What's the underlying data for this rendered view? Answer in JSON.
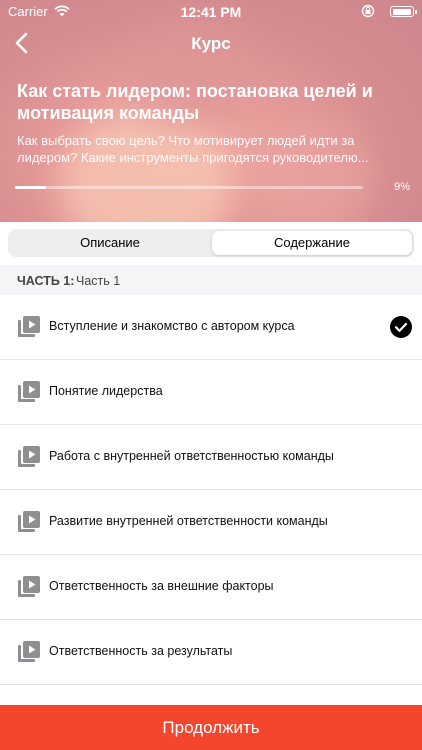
{
  "status_bar": {
    "carrier": "Carrier",
    "time": "12:41 PM"
  },
  "nav": {
    "title": "Курс",
    "back_icon": "chevron-left-icon"
  },
  "course": {
    "title": "Как стать лидером: постановка целей и мотивация команды",
    "description": "Как выбрать свою цель? Что мотивирует людей идти за лидером? Какие инструменты пригодятся руководителю...",
    "progress_percent": 9,
    "progress_label": "9%"
  },
  "tabs": [
    {
      "label": "Описание",
      "selected": false
    },
    {
      "label": "Содержание",
      "selected": true
    }
  ],
  "section": {
    "label": "ЧАСТЬ 1:",
    "value": "Часть 1"
  },
  "lessons": [
    {
      "title": "Вступление и знакомство с автором курса",
      "completed": true,
      "icon": "video-playlist-icon"
    },
    {
      "title": "Понятие лидерства",
      "completed": false,
      "icon": "video-playlist-icon"
    },
    {
      "title": "Работа с внутренней ответственностью команды",
      "completed": false,
      "icon": "video-playlist-icon"
    },
    {
      "title": "Развитие внутренней ответственности команды",
      "completed": false,
      "icon": "video-playlist-icon"
    },
    {
      "title": "Ответственность за внешние факторы",
      "completed": false,
      "icon": "video-playlist-icon"
    },
    {
      "title": "Ответственность за результаты",
      "completed": false,
      "icon": "video-playlist-icon"
    }
  ],
  "footer": {
    "continue_label": "Продолжить"
  },
  "colors": {
    "accent": "#f4452d",
    "hero": "#e59a98"
  }
}
